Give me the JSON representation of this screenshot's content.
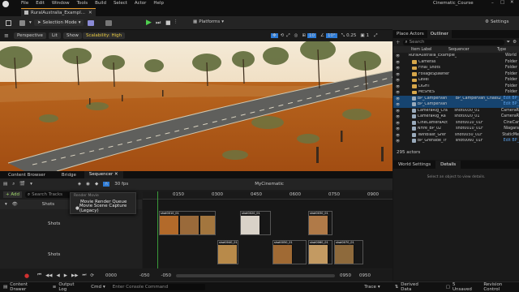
{
  "window": {
    "menu": [
      "File",
      "Edit",
      "Window",
      "Tools",
      "Build",
      "Select",
      "Actor",
      "Help"
    ],
    "project_name": "Cinematic_Course",
    "level_tab": "RuralAustralia_Exampl...",
    "settings_label": "Settings"
  },
  "toolbar": {
    "selection_mode": "Selection Mode",
    "platforms": "Platforms"
  },
  "viewport": {
    "perspective": "Perspective",
    "lit": "Lit",
    "show": "Show",
    "scalability": "Scalability: High",
    "grid_value": "10",
    "angle_value": "10°",
    "scale_value": "0.25",
    "camera_speed": "1"
  },
  "outliner": {
    "tabs": [
      "Place Actors",
      "Outliner"
    ],
    "search_placeholder": "Search",
    "columns": [
      "Item Label",
      "Sequencer",
      "Type"
    ],
    "rows": [
      {
        "label": "RuralAustralia_Example_01 (Editor)",
        "seq": "",
        "type": "World",
        "kind": "world",
        "indent": 0
      },
      {
        "label": "Cameras",
        "seq": "",
        "type": "Folder",
        "kind": "folder",
        "indent": 1
      },
      {
        "label": "Final_Shots",
        "seq": "",
        "type": "Folder",
        "kind": "folder",
        "indent": 1
      },
      {
        "label": "FoliageSpawner",
        "seq": "",
        "type": "Folder",
        "kind": "folder",
        "indent": 1
      },
      {
        "label": "Level",
        "seq": "",
        "type": "Folder",
        "kind": "folder",
        "indent": 1
      },
      {
        "label": "LIGHT",
        "seq": "",
        "type": "Folder",
        "kind": "folder",
        "indent": 1
      },
      {
        "label": "MESHES",
        "seq": "",
        "type": "Folder",
        "kind": "folder",
        "indent": 1
      },
      {
        "label": "BP_Campervan",
        "seq": "BP_Campervan_Chass2_",
        "type": "Edit BP_",
        "kind": "actor",
        "indent": 1,
        "sel": true
      },
      {
        "label": "BP_Campervan",
        "seq": "",
        "type": "Edit BP_",
        "kind": "actor",
        "indent": 1,
        "sel": true
      },
      {
        "label": "CameraRig_Cra",
        "seq": "shot0030_01",
        "type": "CameraR",
        "kind": "actor",
        "indent": 1
      },
      {
        "label": "CameraRig_Ra",
        "seq": "shot0020_01",
        "type": "CameraR",
        "kind": "actor",
        "indent": 1
      },
      {
        "label": "CineCameraAct",
        "seq": "shot0010_01F",
        "type": "CineCar",
        "kind": "actor",
        "indent": 1
      },
      {
        "label": "NFire_BP_02",
        "seq": "shot0010_01F",
        "type": "Niagara",
        "kind": "actor",
        "indent": 1
      },
      {
        "label": "TwinBlast_Grer",
        "seq": "shot0050_01F",
        "type": "StaticMe",
        "kind": "actor",
        "indent": 1
      },
      {
        "label": "BP_Grenade_Tr",
        "seq": "shot0060_01F",
        "type": "Edit BP_",
        "kind": "actor",
        "indent": 1
      }
    ],
    "actor_count": "295 actors"
  },
  "details": {
    "tabs": [
      "World Settings",
      "Details"
    ],
    "empty_message": "Select an object to view details."
  },
  "bottom_tabs": [
    "Content Browser",
    "Bridge",
    "Sequencer"
  ],
  "sequencer": {
    "fps": "30 fps",
    "sequence_name": "MyCinematic",
    "add_label": "+ Add",
    "search_placeholder": "Search Tracks",
    "current_frame": "0000",
    "ruler_ticks": [
      "0150",
      "0300",
      "0450",
      "0600",
      "0750",
      "0900"
    ],
    "tracks": [
      "Shots",
      "Shots",
      "Shots"
    ],
    "start_frame": "0000",
    "range_start": "-050",
    "range_neg": "-050",
    "range_end": "0950",
    "range_end2": "0950",
    "shot_labels": [
      "shot0010_01",
      "shot0020_01",
      "shot0030_01",
      "shot0040_01",
      "shot0050_01",
      "shot0060_01",
      "shot0070_01"
    ]
  },
  "render_menu": {
    "header": "Render Movie",
    "items": [
      "Movie Render Queue",
      "Movie Scene Capture (Legacy)"
    ],
    "selected_index": 1
  },
  "statusbar": {
    "content_drawer": "Content Drawer",
    "output_log": "Output Log",
    "cmd": "Cmd",
    "console_placeholder": "Enter Console Command",
    "trace": "Trace",
    "derived_data": "Derived Data",
    "unsaved": "5 Unsaved",
    "revision_control": "Revision Control"
  }
}
